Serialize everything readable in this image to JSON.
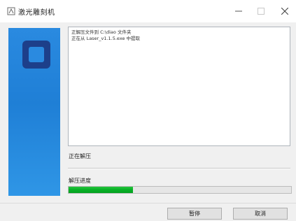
{
  "window": {
    "title": "激光雕刻机",
    "minimize_icon": "minimize-icon",
    "maximize_icon": "maximize-icon",
    "close_icon": "close-icon"
  },
  "banner": {
    "logo_icon": "installer-logo-icon",
    "color": "#2a8ae0"
  },
  "log": {
    "lines": [
      "正解压文件到 C:\\diao 文件夹",
      "正在从 Laser_v1.1.5.exe 中提取"
    ]
  },
  "status": {
    "label": "正在解压"
  },
  "progress": {
    "label": "解压进度",
    "fraction": 0.29,
    "color": "#06b025"
  },
  "buttons": {
    "pause": "暂停",
    "cancel": "取消"
  }
}
